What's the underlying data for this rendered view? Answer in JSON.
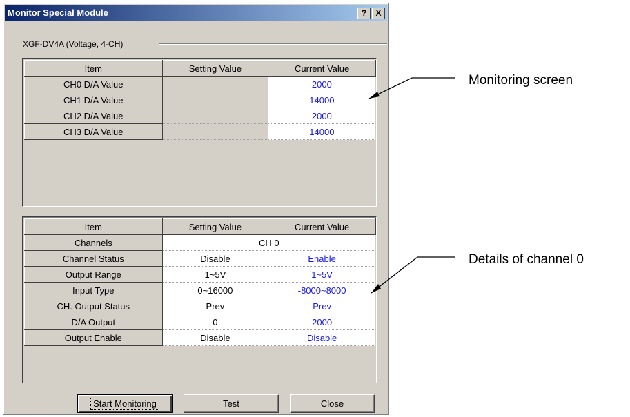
{
  "window": {
    "title": "Monitor Special Module",
    "help_glyph": "?",
    "close_glyph": "X"
  },
  "module_label": "XGF-DV4A (Voltage, 4-CH)",
  "monitor_table": {
    "headers": [
      "Item",
      "Setting Value",
      "Current Value"
    ],
    "rows": [
      {
        "item": "CH0 D/A Value",
        "setting": "",
        "current": "2000"
      },
      {
        "item": "CH1 D/A Value",
        "setting": "",
        "current": "14000"
      },
      {
        "item": "CH2 D/A Value",
        "setting": "",
        "current": "2000"
      },
      {
        "item": "CH3 D/A Value",
        "setting": "",
        "current": "14000"
      }
    ]
  },
  "detail_table": {
    "headers": [
      "Item",
      "Setting Value",
      "Current Value"
    ],
    "channels_label": "Channels",
    "channels_value": "CH 0",
    "rows": [
      {
        "item": "Channel Status",
        "setting": "Disable",
        "current": "Enable"
      },
      {
        "item": "Output Range",
        "setting": "1~5V",
        "current": "1~5V"
      },
      {
        "item": "Input Type",
        "setting": "0~16000",
        "current": "-8000~8000"
      },
      {
        "item": "CH. Output Status",
        "setting": "Prev",
        "current": "Prev"
      },
      {
        "item": "D/A Output",
        "setting": "0",
        "current": "2000"
      },
      {
        "item": "Output Enable",
        "setting": "Disable",
        "current": "Disable"
      }
    ]
  },
  "buttons": {
    "start": "Start Monitoring",
    "test": "Test",
    "close": "Close"
  },
  "annotations": {
    "monitoring": "Monitoring screen",
    "details": "Details of channel 0"
  },
  "colors": {
    "title_bar": "#0a246a",
    "value_text": "#1a1ae0",
    "face": "#d4d0c8"
  }
}
